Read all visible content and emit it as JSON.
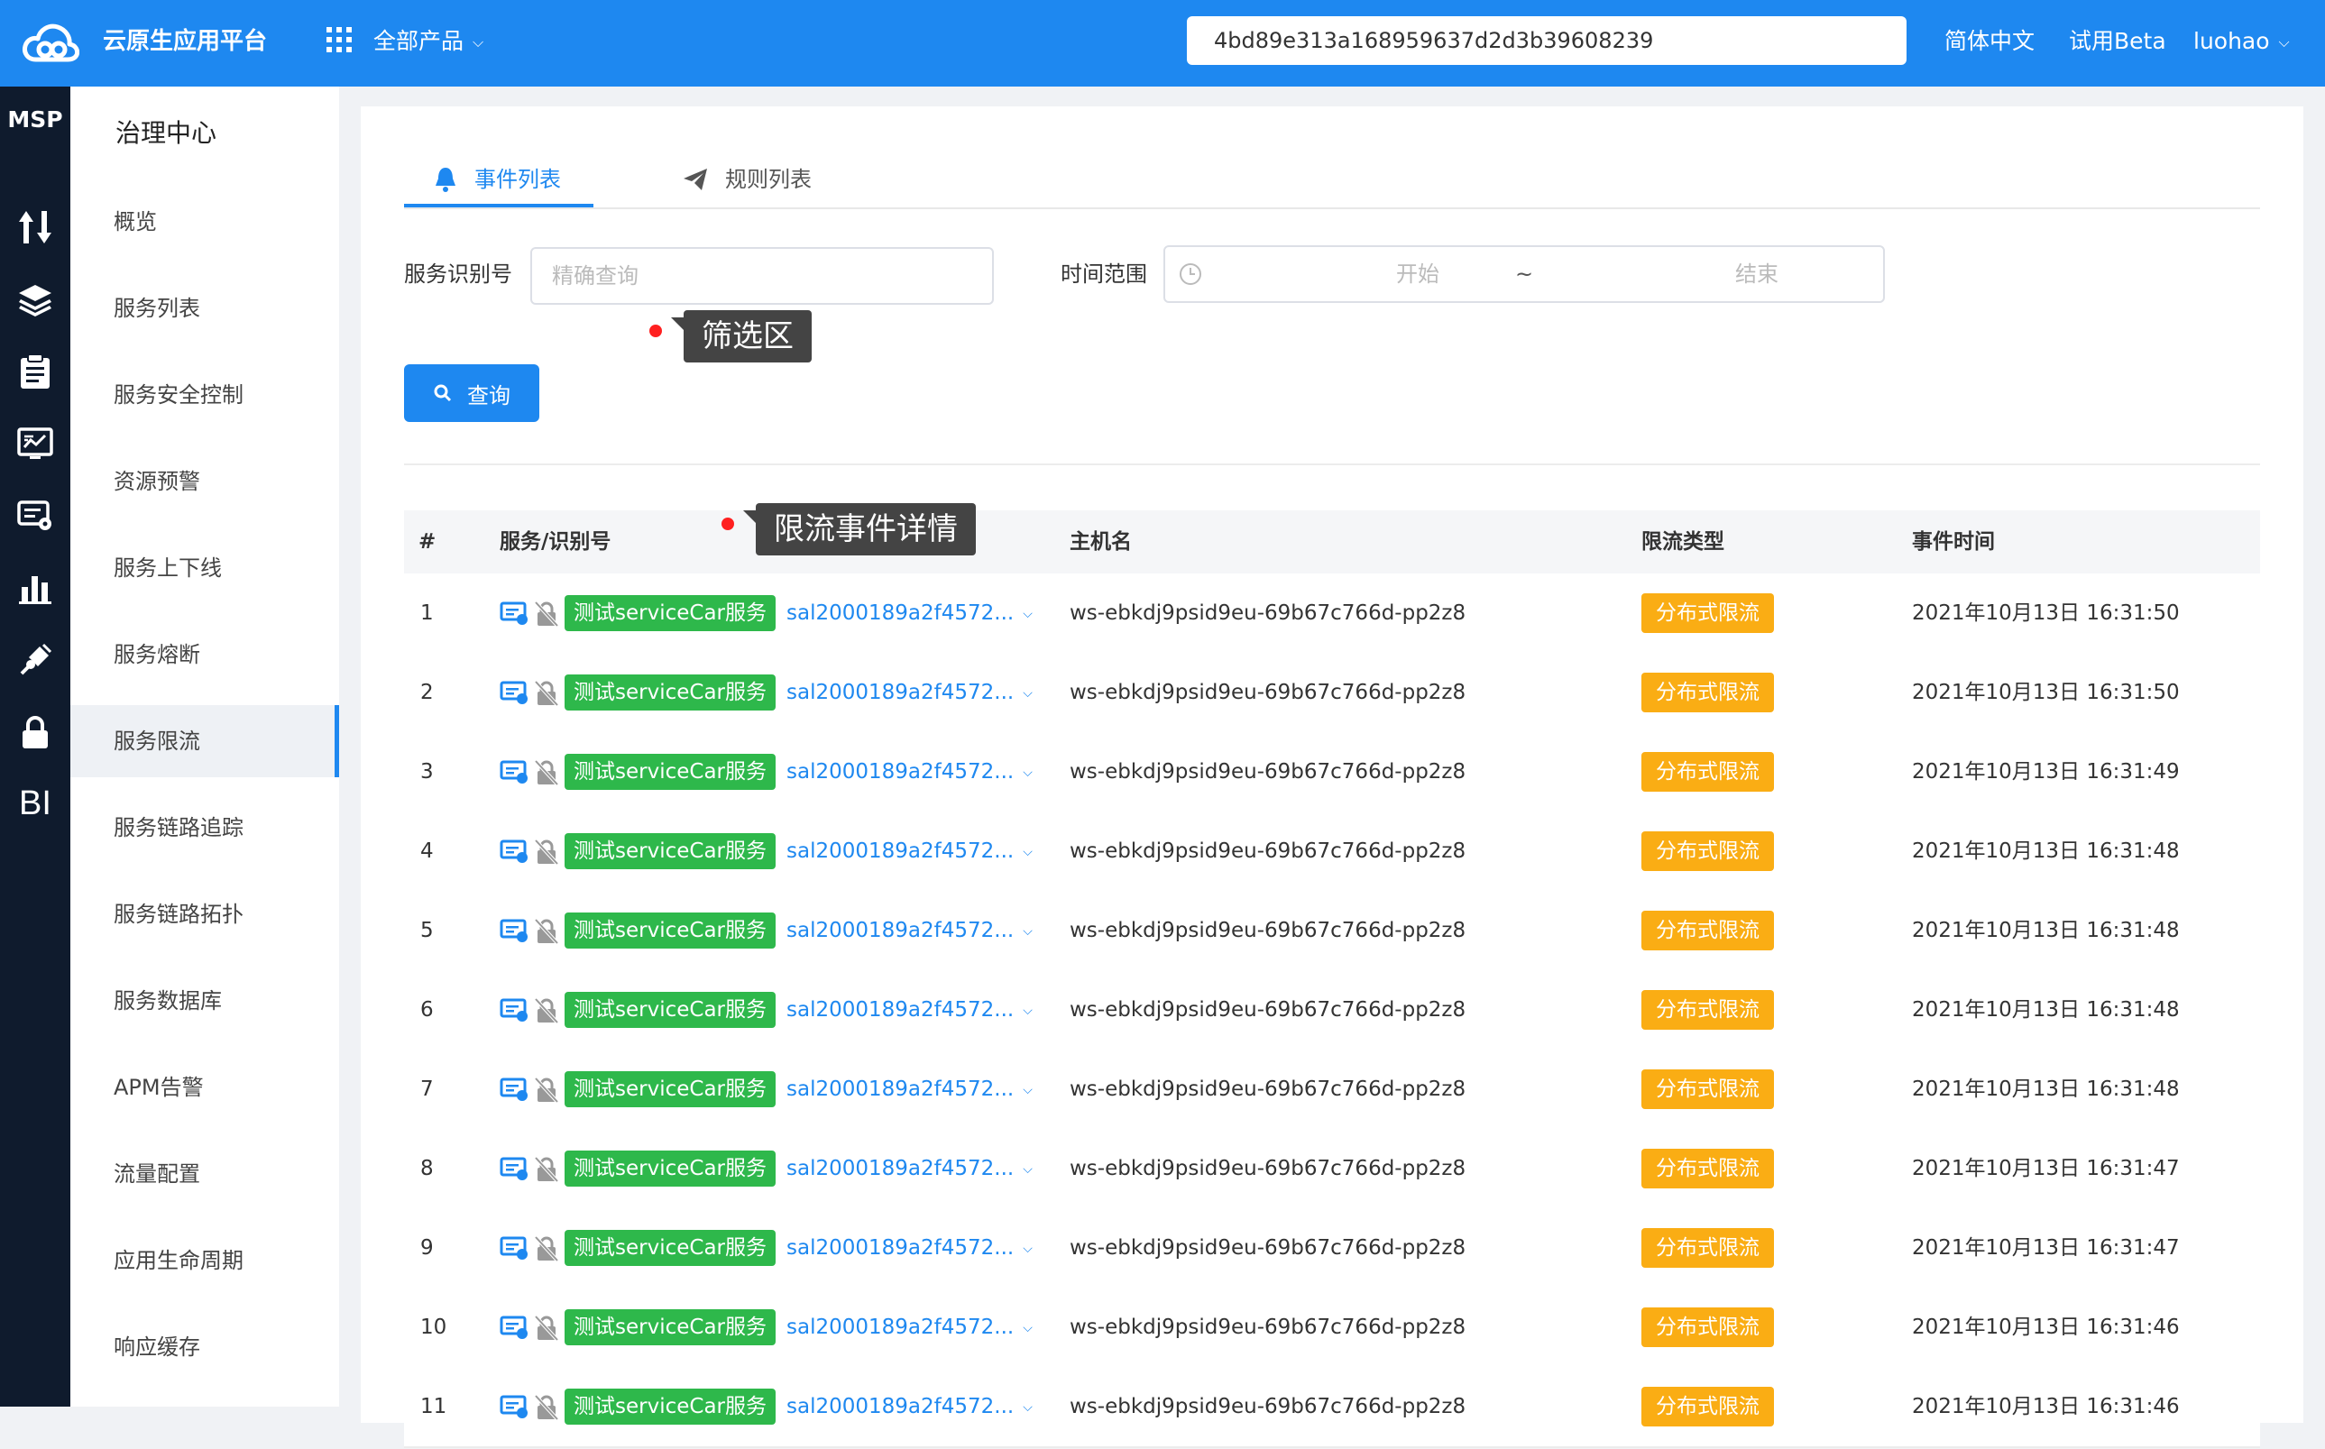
{
  "header": {
    "app_title": "云原生应用平台",
    "all_products": "全部产品",
    "search_value": "4bd89e313a168959637d2d3b39608239",
    "language": "简体中文",
    "beta": "试用Beta",
    "user": "luohao"
  },
  "rail": {
    "brand": "MSP",
    "icons": [
      "transfer-icon",
      "layers-icon",
      "clipboard-icon",
      "monitor-chart-icon",
      "card-settings-icon",
      "bar-chart-icon",
      "plug-icon",
      "lock-icon"
    ],
    "bi_label": "BI"
  },
  "menu": {
    "title": "治理中心",
    "items": [
      {
        "label": "概览"
      },
      {
        "label": "服务列表"
      },
      {
        "label": "服务安全控制"
      },
      {
        "label": "资源预警"
      },
      {
        "label": "服务上下线"
      },
      {
        "label": "服务熔断"
      },
      {
        "label": "服务限流",
        "active": true
      },
      {
        "label": "服务链路追踪"
      },
      {
        "label": "服务链路拓扑"
      },
      {
        "label": "服务数据库"
      },
      {
        "label": "APM告警"
      },
      {
        "label": "流量配置"
      },
      {
        "label": "应用生命周期"
      },
      {
        "label": "响应缓存"
      }
    ]
  },
  "tabs": [
    {
      "label": "事件列表",
      "active": true
    },
    {
      "label": "规则列表"
    }
  ],
  "filter": {
    "service_label": "服务识别号",
    "service_placeholder": "精确查询",
    "time_label": "时间范围",
    "time_start": "开始",
    "time_sep": "~",
    "time_end": "结束",
    "query_button": "查询"
  },
  "annotations": {
    "filter_area": "筛选区",
    "event_details": "限流事件详情"
  },
  "table": {
    "headers": [
      "#",
      "服务/识别号",
      "主机名",
      "限流类型",
      "事件时间"
    ],
    "rows": [
      {
        "idx": "1",
        "service": "测试serviceCar服务",
        "service_id": "sal2000189a2f4572...",
        "host": "ws-ebkdj9psid9eu-69b67c766d-pp2z8",
        "type": "分布式限流",
        "time": "2021年10月13日 16:31:50"
      },
      {
        "idx": "2",
        "service": "测试serviceCar服务",
        "service_id": "sal2000189a2f4572...",
        "host": "ws-ebkdj9psid9eu-69b67c766d-pp2z8",
        "type": "分布式限流",
        "time": "2021年10月13日 16:31:50"
      },
      {
        "idx": "3",
        "service": "测试serviceCar服务",
        "service_id": "sal2000189a2f4572...",
        "host": "ws-ebkdj9psid9eu-69b67c766d-pp2z8",
        "type": "分布式限流",
        "time": "2021年10月13日 16:31:49"
      },
      {
        "idx": "4",
        "service": "测试serviceCar服务",
        "service_id": "sal2000189a2f4572...",
        "host": "ws-ebkdj9psid9eu-69b67c766d-pp2z8",
        "type": "分布式限流",
        "time": "2021年10月13日 16:31:48"
      },
      {
        "idx": "5",
        "service": "测试serviceCar服务",
        "service_id": "sal2000189a2f4572...",
        "host": "ws-ebkdj9psid9eu-69b67c766d-pp2z8",
        "type": "分布式限流",
        "time": "2021年10月13日 16:31:48"
      },
      {
        "idx": "6",
        "service": "测试serviceCar服务",
        "service_id": "sal2000189a2f4572...",
        "host": "ws-ebkdj9psid9eu-69b67c766d-pp2z8",
        "type": "分布式限流",
        "time": "2021年10月13日 16:31:48"
      },
      {
        "idx": "7",
        "service": "测试serviceCar服务",
        "service_id": "sal2000189a2f4572...",
        "host": "ws-ebkdj9psid9eu-69b67c766d-pp2z8",
        "type": "分布式限流",
        "time": "2021年10月13日 16:31:48"
      },
      {
        "idx": "8",
        "service": "测试serviceCar服务",
        "service_id": "sal2000189a2f4572...",
        "host": "ws-ebkdj9psid9eu-69b67c766d-pp2z8",
        "type": "分布式限流",
        "time": "2021年10月13日 16:31:47"
      },
      {
        "idx": "9",
        "service": "测试serviceCar服务",
        "service_id": "sal2000189a2f4572...",
        "host": "ws-ebkdj9psid9eu-69b67c766d-pp2z8",
        "type": "分布式限流",
        "time": "2021年10月13日 16:31:47"
      },
      {
        "idx": "10",
        "service": "测试serviceCar服务",
        "service_id": "sal2000189a2f4572...",
        "host": "ws-ebkdj9psid9eu-69b67c766d-pp2z8",
        "type": "分布式限流",
        "time": "2021年10月13日 16:31:46"
      },
      {
        "idx": "11",
        "service": "测试serviceCar服务",
        "service_id": "sal2000189a2f4572...",
        "host": "ws-ebkdj9psid9eu-69b67c766d-pp2z8",
        "type": "分布式限流",
        "time": "2021年10月13日 16:31:46"
      }
    ]
  },
  "colors": {
    "primary": "#1e88f0",
    "rail_bg": "#0f1b2d",
    "service_tag": "#2eb84b",
    "type_tag": "#faad14",
    "annotation_dot": "#ff2020"
  }
}
